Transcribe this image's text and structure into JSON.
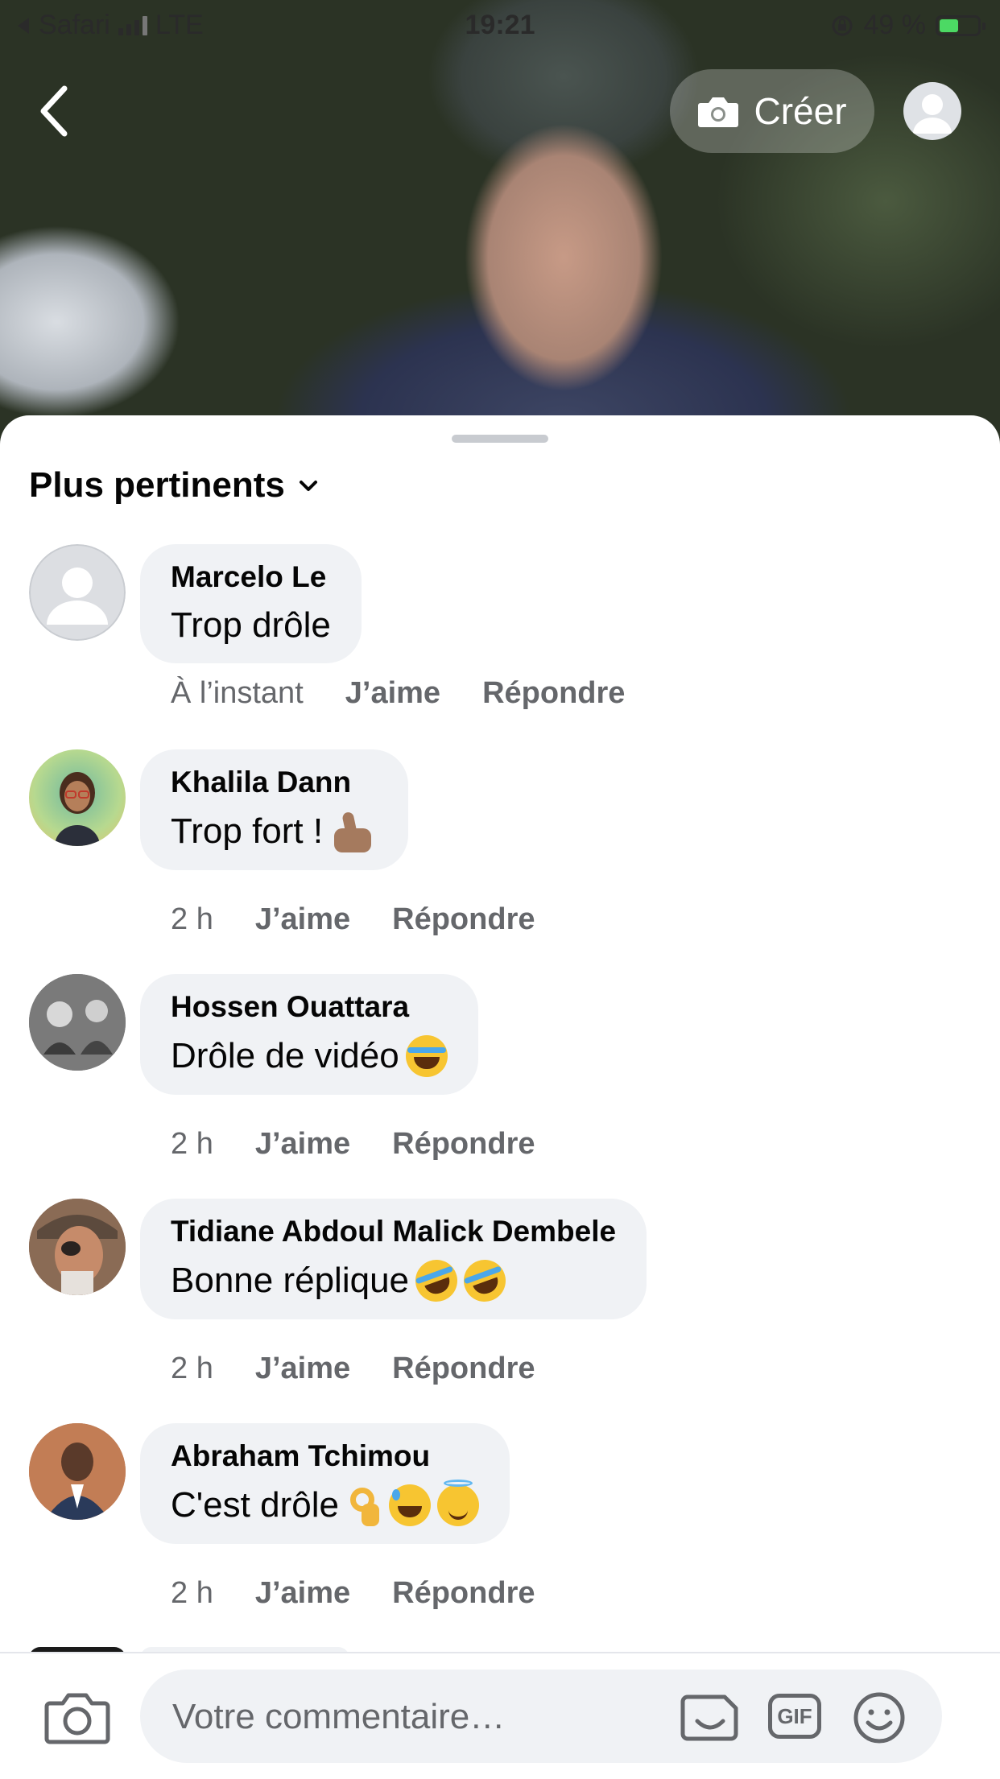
{
  "status_bar": {
    "back_app": "Safari",
    "network": "LTE",
    "time": "19:21",
    "battery": "49 %",
    "battery_level": 0.49
  },
  "header": {
    "create_label": "Créer",
    "icons": [
      "chevron-left-icon",
      "camera-icon",
      "profile-avatar"
    ]
  },
  "sort": {
    "label": "Plus pertinents"
  },
  "comments": [
    {
      "author": "Marcelo Le",
      "text": "Trop drôle",
      "emojis": [],
      "time": "À l’instant",
      "like": "J’aime",
      "reply": "Répondre"
    },
    {
      "author": "Khalila Dann",
      "text": "Trop fort !",
      "emojis": [
        "thumbs-up"
      ],
      "time": "2 h",
      "like": "J’aime",
      "reply": "Répondre"
    },
    {
      "author": "Hossen Ouattara",
      "text": "Drôle de vidéo",
      "emojis": [
        "face-with-tears-of-joy"
      ],
      "time": "2 h",
      "like": "J’aime",
      "reply": "Répondre"
    },
    {
      "author": "Tidiane Abdoul Malick Dembele",
      "text": "Bonne réplique",
      "emojis": [
        "rolling-on-floor-laughing",
        "rolling-on-floor-laughing"
      ],
      "time": "2 h",
      "like": "J’aime",
      "reply": "Répondre"
    },
    {
      "author": "Abraham Tchimou",
      "text": "C'est drôle",
      "emojis": [
        "ok-hand",
        "grinning-sweat",
        "smiling-halo"
      ],
      "time": "2 h",
      "like": "J’aime",
      "reply": "Répondre"
    }
  ],
  "composer": {
    "placeholder": "Votre commentaire…",
    "gif_label": "GIF"
  },
  "colors": {
    "bubble": "#f0f2f5",
    "meta_text": "#65676b",
    "primary_text": "#050505"
  }
}
